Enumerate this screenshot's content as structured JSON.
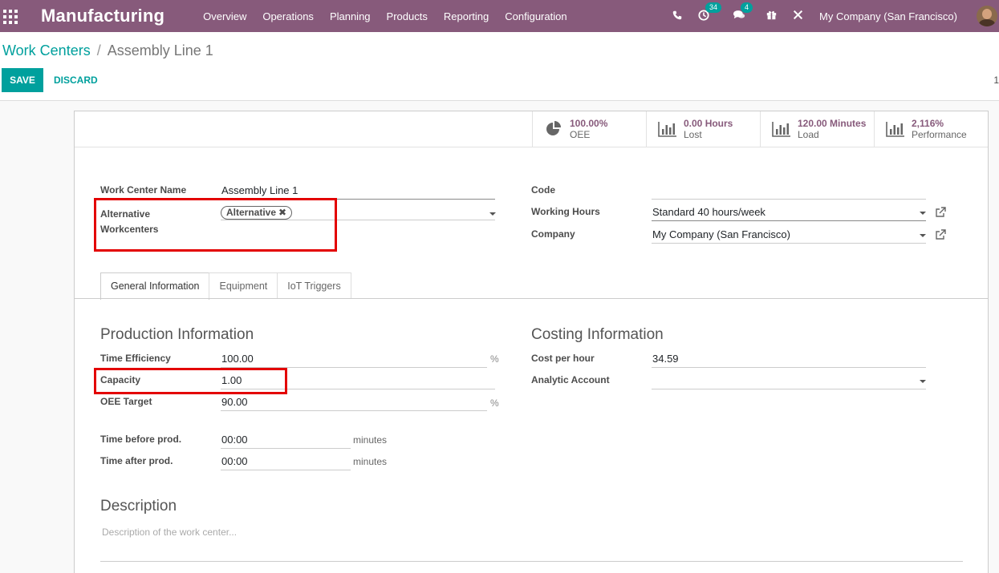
{
  "nav": {
    "brand": "Manufacturing",
    "menu": [
      "Overview",
      "Operations",
      "Planning",
      "Products",
      "Reporting",
      "Configuration"
    ],
    "activity_count": "34",
    "message_count": "4",
    "company": "My Company (San Francisco)"
  },
  "breadcrumb": {
    "parent": "Work Centers",
    "separator": "/",
    "current": "Assembly Line 1"
  },
  "actions": {
    "save": "SAVE",
    "discard": "DISCARD",
    "pager": "1"
  },
  "stats": [
    {
      "value": "100.00%",
      "label": "OEE",
      "icon": "pie-chart-icon"
    },
    {
      "value": "0.00 Hours",
      "label": "Lost",
      "icon": "bar-chart-icon"
    },
    {
      "value": "120.00 Minutes",
      "label": "Load",
      "icon": "bar-chart-icon"
    },
    {
      "value": "2,116%",
      "label": "Performance",
      "icon": "bar-chart-icon"
    }
  ],
  "form": {
    "name_label": "Work Center Name",
    "name_value": "Assembly Line 1",
    "alt_label": "Alternative Workcenters",
    "alt_tag": "Alternative",
    "code_label": "Code",
    "code_value": "",
    "hours_label": "Working Hours",
    "hours_value": "Standard 40 hours/week",
    "company_label": "Company",
    "company_value": "My Company (San Francisco)"
  },
  "tabs": [
    "General Information",
    "Equipment",
    "IoT Triggers"
  ],
  "production": {
    "title": "Production Information",
    "efficiency_label": "Time Efficiency",
    "efficiency_value": "100.00",
    "capacity_label": "Capacity",
    "capacity_value": "1.00",
    "oee_label": "OEE Target",
    "oee_value": "90.00",
    "percent_unit": "%",
    "before_label": "Time before prod.",
    "before_value": "00:00",
    "after_label": "Time after prod.",
    "after_value": "00:00",
    "minutes_unit": "minutes"
  },
  "costing": {
    "title": "Costing Information",
    "cost_label": "Cost per hour",
    "cost_value": "34.59",
    "analytic_label": "Analytic Account",
    "analytic_value": ""
  },
  "description": {
    "title": "Description",
    "placeholder": "Description of the work center..."
  },
  "colors": {
    "nav": "#875a7b",
    "accent": "#00a09d",
    "highlight": "#e30000"
  }
}
